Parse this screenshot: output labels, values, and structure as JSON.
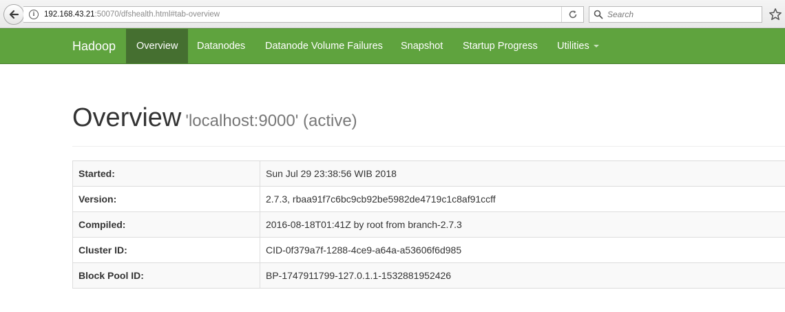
{
  "browser": {
    "url_host": "192.168.43.21",
    "url_rest": ":50070/dfshealth.html#tab-overview",
    "search_placeholder": "Search"
  },
  "navbar": {
    "brand": "Hadoop",
    "items": [
      {
        "label": "Overview",
        "active": true
      },
      {
        "label": "Datanodes"
      },
      {
        "label": "Datanode Volume Failures"
      },
      {
        "label": "Snapshot"
      },
      {
        "label": "Startup Progress"
      },
      {
        "label": "Utilities",
        "dropdown": true
      }
    ]
  },
  "header": {
    "title": "Overview",
    "subtitle": "'localhost:9000' (active)"
  },
  "info": [
    {
      "key": "Started:",
      "value": "Sun Jul 29 23:38:56 WIB 2018"
    },
    {
      "key": "Version:",
      "value": "2.7.3, rbaa91f7c6bc9cb92be5982de4719c1c8af91ccff"
    },
    {
      "key": "Compiled:",
      "value": "2016-08-18T01:41Z by root from branch-2.7.3"
    },
    {
      "key": "Cluster ID:",
      "value": "CID-0f379a7f-1288-4ce9-a64a-a53606f6d985"
    },
    {
      "key": "Block Pool ID:",
      "value": "BP-1747911799-127.0.1.1-1532881952426"
    }
  ],
  "colors": {
    "navbar": "#5fa33e",
    "navbar_active": "#456f30"
  }
}
